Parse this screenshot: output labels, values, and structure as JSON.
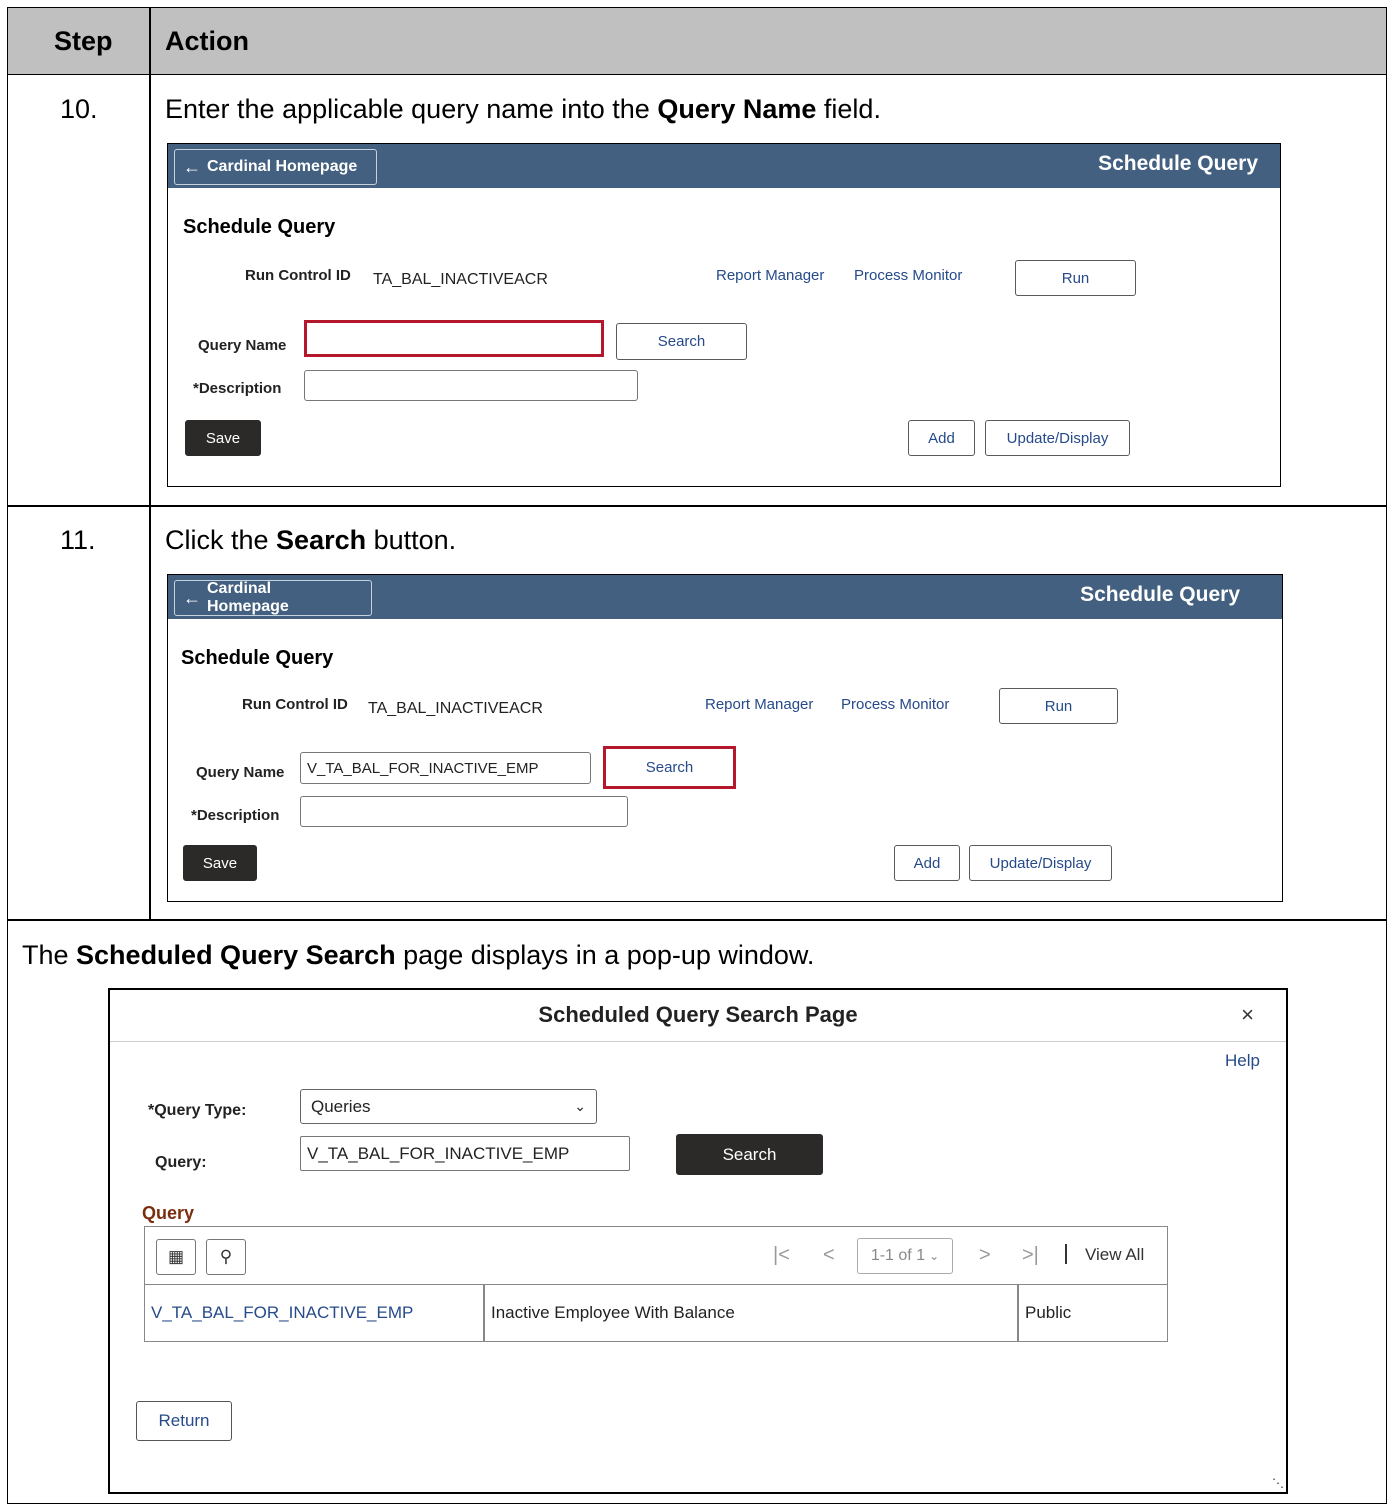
{
  "table": {
    "header_step": "Step",
    "header_action": "Action"
  },
  "step10": {
    "number": "10.",
    "text_before": "Enter the applicable query name into the ",
    "text_bold": "Query Name",
    "text_after": " field."
  },
  "step11": {
    "number": "11.",
    "text_before": "Click the ",
    "text_bold": "Search",
    "text_after": " button."
  },
  "note": {
    "text_before": "The ",
    "text_bold": "Scheduled Query Search",
    "text_after": " page displays in a pop-up window."
  },
  "ps": {
    "home_label": "Cardinal Homepage",
    "banner_title": "Schedule Query",
    "page_title": "Schedule Query",
    "run_control_label": "Run Control ID",
    "run_control_value": "TA_BAL_INACTIVEACR",
    "report_manager": "Report Manager",
    "process_monitor": "Process Monitor",
    "run": "Run",
    "query_name_label": "Query Name",
    "search": "Search",
    "description_label": "*Description",
    "save": "Save",
    "add": "Add",
    "update_display": "Update/Display",
    "screen1_query_value": "",
    "screen2_query_value": "V_TA_BAL_FOR_INACTIVE_EMP"
  },
  "popup": {
    "title": "Scheduled Query Search Page",
    "close": "×",
    "help": "Help",
    "query_type_label": "*Query Type:",
    "query_type_value": "Queries",
    "query_label": "Query:",
    "query_value": "V_TA_BAL_FOR_INACTIVE_EMP",
    "search": "Search",
    "grid_title": "Query",
    "pager": "1-1 of 1",
    "view_all": "View All",
    "rows": [
      {
        "name": "V_TA_BAL_FOR_INACTIVE_EMP",
        "description": "Inactive Employee With Balance",
        "owner": "Public"
      }
    ],
    "return": "Return"
  }
}
